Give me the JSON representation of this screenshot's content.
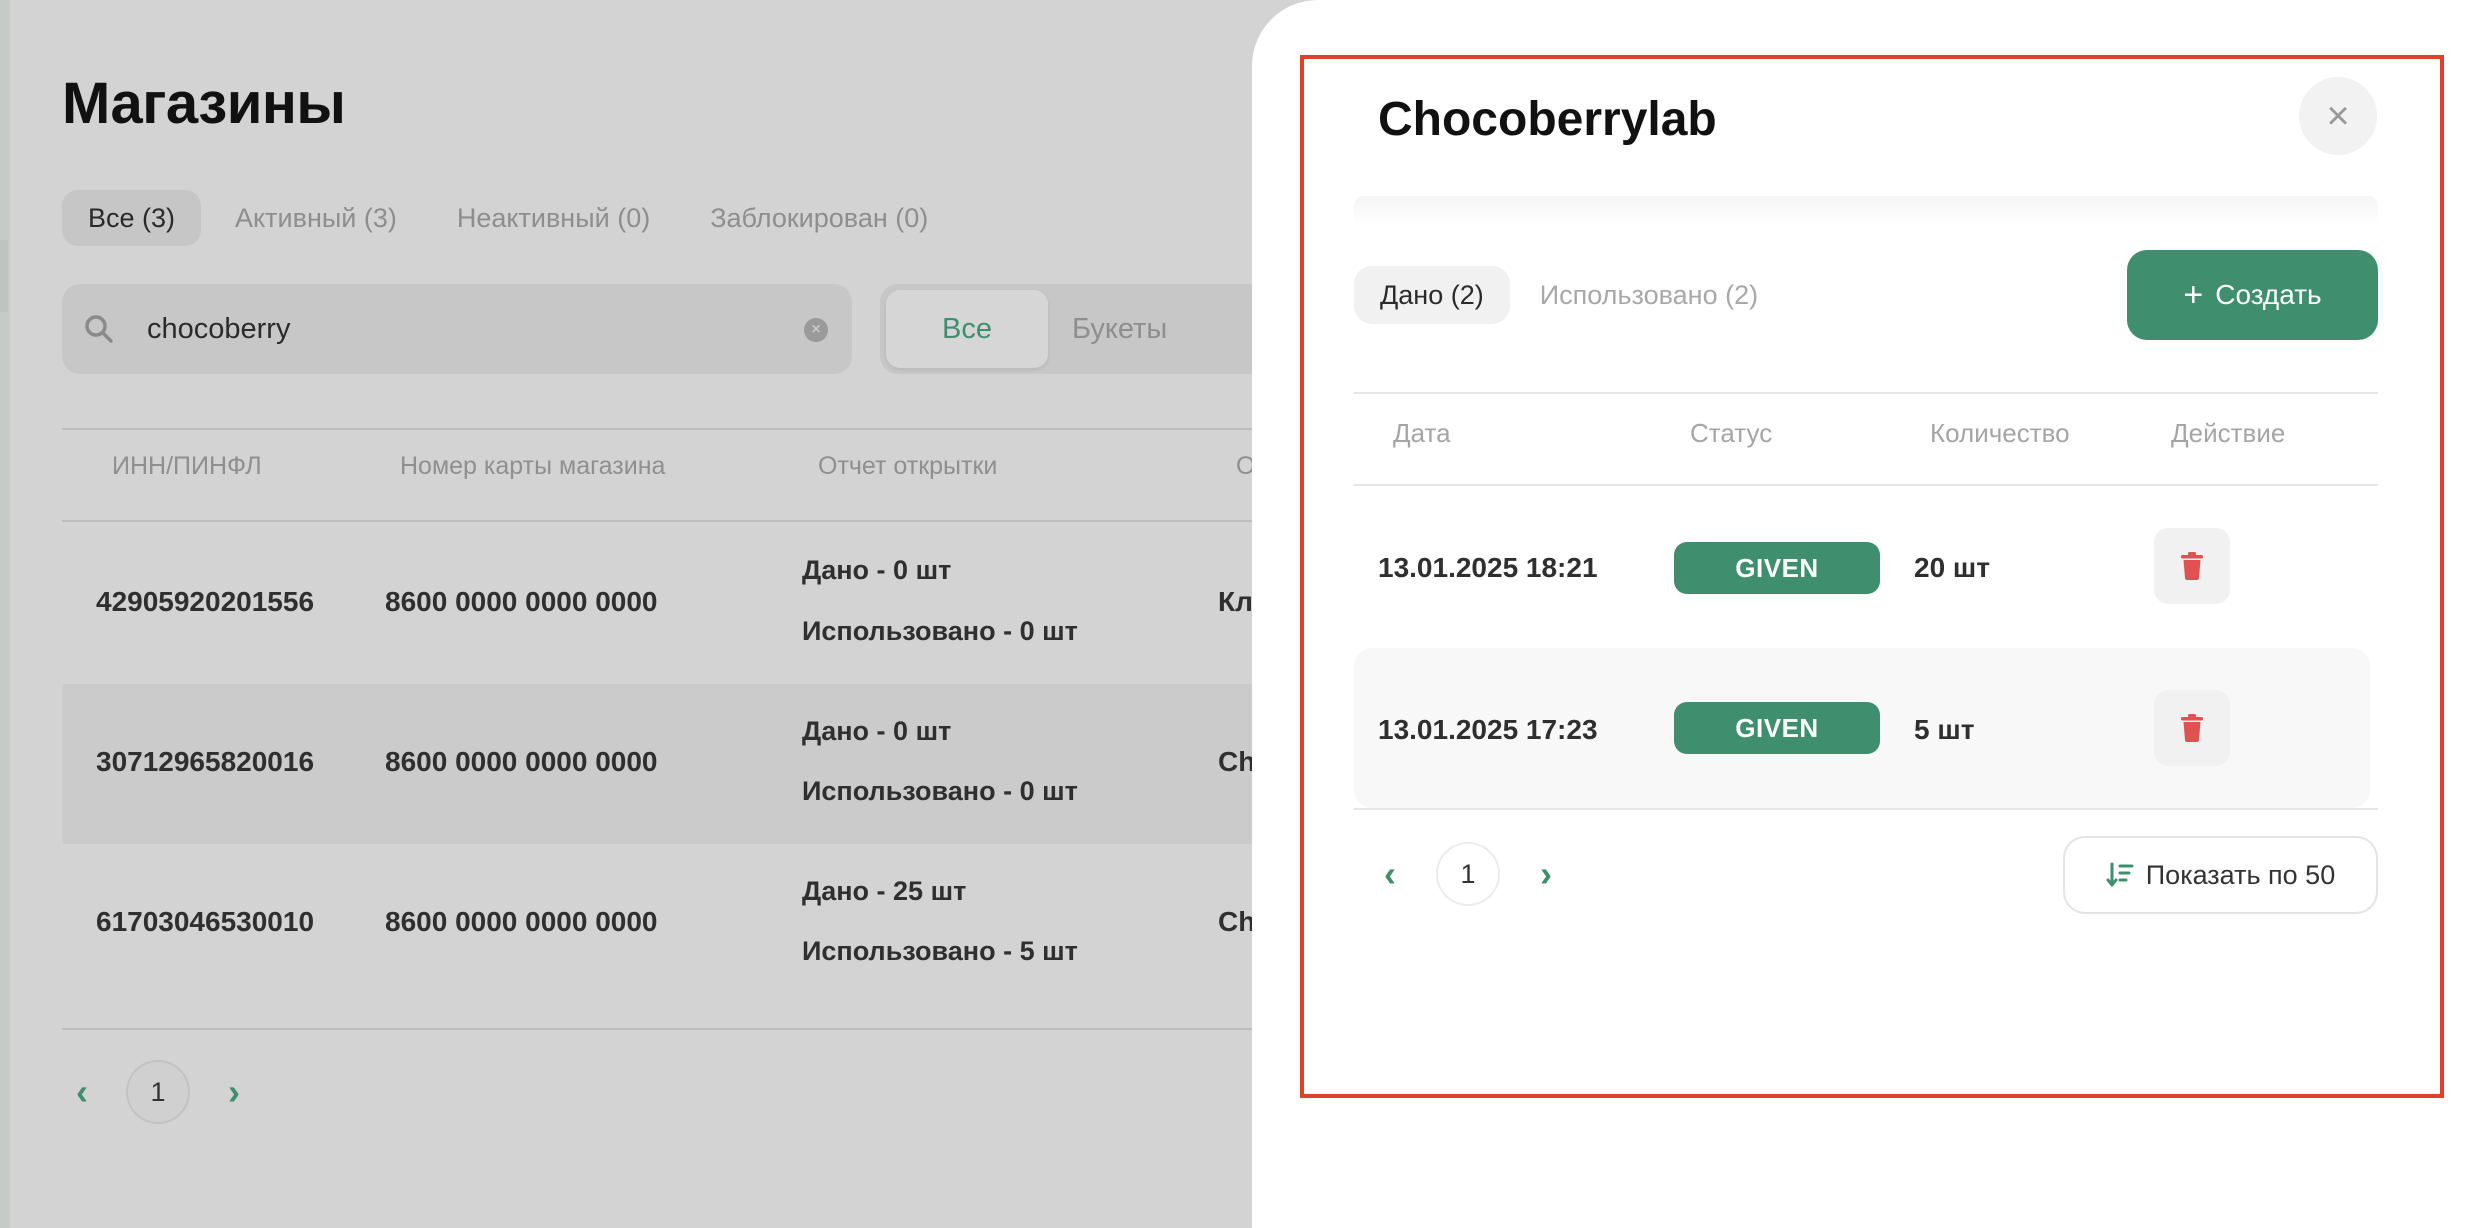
{
  "page": {
    "title": "Магазины",
    "status_tabs": [
      {
        "label": "Все (3)",
        "active": true
      },
      {
        "label": "Активный (3)",
        "active": false
      },
      {
        "label": "Неактивный (0)",
        "active": false
      },
      {
        "label": "Заблокирован (0)",
        "active": false
      }
    ],
    "search": {
      "value": "chocoberry",
      "placeholder": ""
    },
    "segment": [
      {
        "label": "Все",
        "active": true
      },
      {
        "label": "Букеты",
        "active": false
      }
    ],
    "table": {
      "headers": [
        "ИНН/ПИНФЛ",
        "Номер карты магазина",
        "Отчет открытки",
        "О"
      ],
      "rows": [
        {
          "inn": "42905920201556",
          "card": "8600 0000 0000 0000",
          "given": "Дано - 0 шт",
          "used": "Использовано - 0 шт",
          "extra": "Клу"
        },
        {
          "inn": "30712965820016",
          "card": "8600 0000 0000 0000",
          "given": "Дано - 0 шт",
          "used": "Использовано - 0 шт",
          "extra": "Ch"
        },
        {
          "inn": "61703046530010",
          "card": "8600 0000 0000 0000",
          "given": "Дано - 25 шт",
          "used": "Использовано - 5 шт",
          "extra": "Ch"
        }
      ]
    },
    "pager": {
      "page": "1"
    }
  },
  "drawer": {
    "title": "Chocoberrylab",
    "close_icon": "close-icon",
    "tabs": [
      {
        "label": "Дано (2)",
        "active": true
      },
      {
        "label": "Использовано (2)",
        "active": false
      }
    ],
    "create_label": "Создать",
    "headers": {
      "date": "Дата",
      "status": "Статус",
      "qty": "Количество",
      "action": "Действие"
    },
    "rows": [
      {
        "date": "13.01.2025 18:21",
        "status": "GIVEN",
        "qty": "20 шт"
      },
      {
        "date": "13.01.2025 17:23",
        "status": "GIVEN",
        "qty": "5 шт"
      }
    ],
    "pager": {
      "page": "1"
    },
    "show_label": "Показать по 50"
  },
  "colors": {
    "accent": "#3f8f6e",
    "danger": "#e05252",
    "highlight": "#e0412c"
  }
}
